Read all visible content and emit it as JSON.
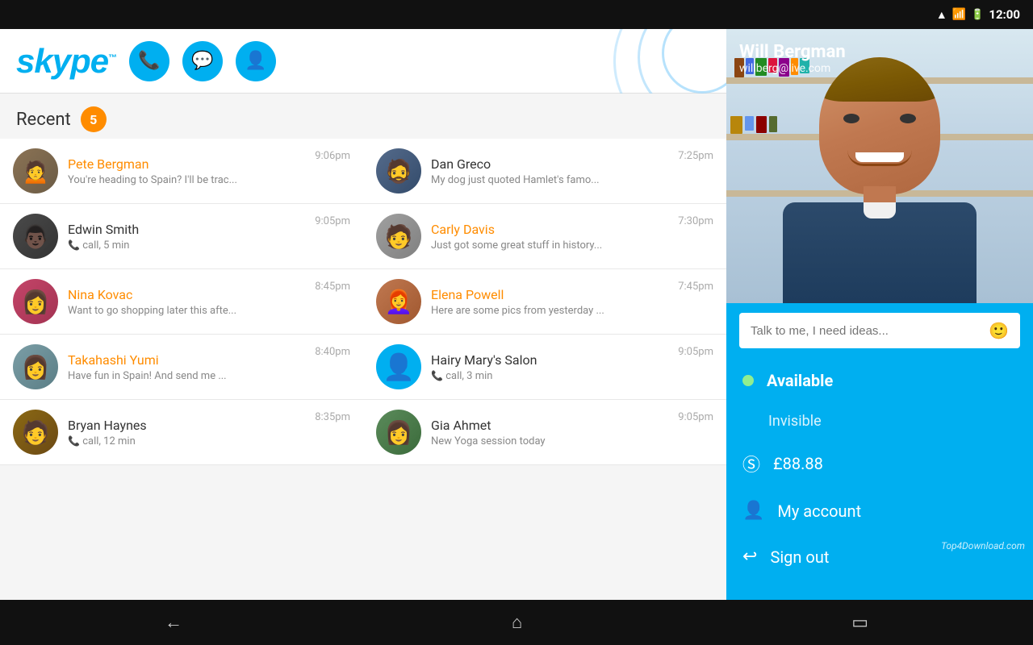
{
  "statusBar": {
    "time": "12:00",
    "wifiIcon": "wifi",
    "signalIcon": "signal",
    "batteryIcon": "battery"
  },
  "header": {
    "logo": "skype",
    "logoTm": "TM",
    "callBtn": "📞",
    "chatBtn": "💬",
    "addBtn": "👤+"
  },
  "recent": {
    "label": "Recent",
    "count": "5"
  },
  "conversations": [
    {
      "id": "pete",
      "name": "Pete Bergman",
      "preview": "You're heading to Spain? I'll be trac...",
      "time": "9:06pm",
      "unread": true,
      "avatarClass": "avatar-pete",
      "avatarEmoji": "👩"
    },
    {
      "id": "dan",
      "name": "Dan Greco",
      "preview": "My dog just quoted Hamlet's famo...",
      "time": "7:25pm",
      "unread": false,
      "avatarClass": "avatar-dan",
      "avatarEmoji": "👨"
    },
    {
      "id": "edwin",
      "name": "Edwin Smith",
      "preview": "call, 5 min",
      "time": "9:05pm",
      "unread": false,
      "isCall": true,
      "avatarClass": "avatar-edwin",
      "avatarEmoji": "👨"
    },
    {
      "id": "carly",
      "name": "Carly Davis",
      "preview": "Just got some great stuff in history...",
      "time": "7:30pm",
      "unread": true,
      "avatarClass": "avatar-carly",
      "avatarEmoji": "🧑"
    },
    {
      "id": "nina",
      "name": "Nina Kovac",
      "preview": "Want to go shopping later this afte...",
      "time": "8:45pm",
      "unread": true,
      "avatarClass": "avatar-nina",
      "avatarEmoji": "👩"
    },
    {
      "id": "elena",
      "name": "Elena Powell",
      "preview": "Here are some pics from yesterday ...",
      "time": "7:45pm",
      "unread": true,
      "avatarClass": "avatar-elena",
      "avatarEmoji": "👩"
    },
    {
      "id": "taka",
      "name": "Takahashi Yumi",
      "preview": "Have fun in Spain! And send me ...",
      "time": "8:40pm",
      "unread": true,
      "avatarClass": "avatar-taka",
      "avatarEmoji": "👩"
    },
    {
      "id": "salon",
      "name": "Hairy Mary's Salon",
      "preview": "call, 3 min",
      "time": "9:05pm",
      "unread": false,
      "isCall": true,
      "avatarClass": "avatar-salon",
      "avatarEmoji": "👤"
    },
    {
      "id": "bryan",
      "name": "Bryan Haynes",
      "preview": "call, 12 min",
      "time": "8:35pm",
      "unread": false,
      "isCall": true,
      "avatarClass": "avatar-bryan",
      "avatarEmoji": "👨"
    },
    {
      "id": "gia",
      "name": "Gia Ahmet",
      "preview": "New Yoga session today",
      "time": "9:05pm",
      "unread": false,
      "avatarClass": "avatar-gia",
      "avatarEmoji": "👩"
    }
  ],
  "profile": {
    "name": "Will Bergman",
    "email": "willberg@live.com",
    "statusPlaceholder": "Talk to me, I need ideas...",
    "statusAvailable": "Available",
    "statusInvisible": "Invisible",
    "credit": "£88.88",
    "myAccount": "My account",
    "signOut": "Sign out"
  },
  "navBar": {
    "backBtn": "←",
    "homeBtn": "⬡",
    "recentBtn": "▭"
  },
  "watermark": "Top4Download.com"
}
